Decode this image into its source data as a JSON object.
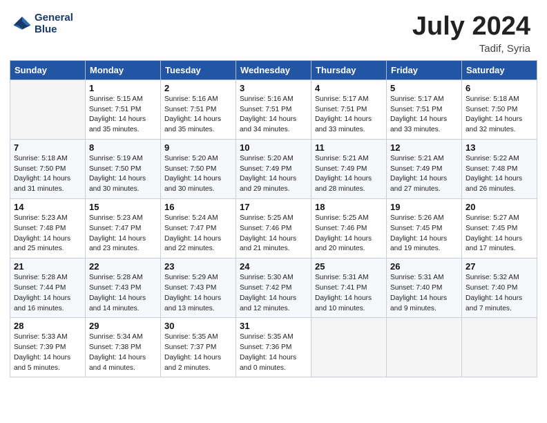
{
  "header": {
    "logo_line1": "General",
    "logo_line2": "Blue",
    "month": "July 2024",
    "location": "Tadif, Syria"
  },
  "weekdays": [
    "Sunday",
    "Monday",
    "Tuesday",
    "Wednesday",
    "Thursday",
    "Friday",
    "Saturday"
  ],
  "weeks": [
    [
      {
        "day": "",
        "info": ""
      },
      {
        "day": "1",
        "info": "Sunrise: 5:15 AM\nSunset: 7:51 PM\nDaylight: 14 hours\nand 35 minutes."
      },
      {
        "day": "2",
        "info": "Sunrise: 5:16 AM\nSunset: 7:51 PM\nDaylight: 14 hours\nand 35 minutes."
      },
      {
        "day": "3",
        "info": "Sunrise: 5:16 AM\nSunset: 7:51 PM\nDaylight: 14 hours\nand 34 minutes."
      },
      {
        "day": "4",
        "info": "Sunrise: 5:17 AM\nSunset: 7:51 PM\nDaylight: 14 hours\nand 33 minutes."
      },
      {
        "day": "5",
        "info": "Sunrise: 5:17 AM\nSunset: 7:51 PM\nDaylight: 14 hours\nand 33 minutes."
      },
      {
        "day": "6",
        "info": "Sunrise: 5:18 AM\nSunset: 7:50 PM\nDaylight: 14 hours\nand 32 minutes."
      }
    ],
    [
      {
        "day": "7",
        "info": "Sunrise: 5:18 AM\nSunset: 7:50 PM\nDaylight: 14 hours\nand 31 minutes."
      },
      {
        "day": "8",
        "info": "Sunrise: 5:19 AM\nSunset: 7:50 PM\nDaylight: 14 hours\nand 30 minutes."
      },
      {
        "day": "9",
        "info": "Sunrise: 5:20 AM\nSunset: 7:50 PM\nDaylight: 14 hours\nand 30 minutes."
      },
      {
        "day": "10",
        "info": "Sunrise: 5:20 AM\nSunset: 7:49 PM\nDaylight: 14 hours\nand 29 minutes."
      },
      {
        "day": "11",
        "info": "Sunrise: 5:21 AM\nSunset: 7:49 PM\nDaylight: 14 hours\nand 28 minutes."
      },
      {
        "day": "12",
        "info": "Sunrise: 5:21 AM\nSunset: 7:49 PM\nDaylight: 14 hours\nand 27 minutes."
      },
      {
        "day": "13",
        "info": "Sunrise: 5:22 AM\nSunset: 7:48 PM\nDaylight: 14 hours\nand 26 minutes."
      }
    ],
    [
      {
        "day": "14",
        "info": "Sunrise: 5:23 AM\nSunset: 7:48 PM\nDaylight: 14 hours\nand 25 minutes."
      },
      {
        "day": "15",
        "info": "Sunrise: 5:23 AM\nSunset: 7:47 PM\nDaylight: 14 hours\nand 23 minutes."
      },
      {
        "day": "16",
        "info": "Sunrise: 5:24 AM\nSunset: 7:47 PM\nDaylight: 14 hours\nand 22 minutes."
      },
      {
        "day": "17",
        "info": "Sunrise: 5:25 AM\nSunset: 7:46 PM\nDaylight: 14 hours\nand 21 minutes."
      },
      {
        "day": "18",
        "info": "Sunrise: 5:25 AM\nSunset: 7:46 PM\nDaylight: 14 hours\nand 20 minutes."
      },
      {
        "day": "19",
        "info": "Sunrise: 5:26 AM\nSunset: 7:45 PM\nDaylight: 14 hours\nand 19 minutes."
      },
      {
        "day": "20",
        "info": "Sunrise: 5:27 AM\nSunset: 7:45 PM\nDaylight: 14 hours\nand 17 minutes."
      }
    ],
    [
      {
        "day": "21",
        "info": "Sunrise: 5:28 AM\nSunset: 7:44 PM\nDaylight: 14 hours\nand 16 minutes."
      },
      {
        "day": "22",
        "info": "Sunrise: 5:28 AM\nSunset: 7:43 PM\nDaylight: 14 hours\nand 14 minutes."
      },
      {
        "day": "23",
        "info": "Sunrise: 5:29 AM\nSunset: 7:43 PM\nDaylight: 14 hours\nand 13 minutes."
      },
      {
        "day": "24",
        "info": "Sunrise: 5:30 AM\nSunset: 7:42 PM\nDaylight: 14 hours\nand 12 minutes."
      },
      {
        "day": "25",
        "info": "Sunrise: 5:31 AM\nSunset: 7:41 PM\nDaylight: 14 hours\nand 10 minutes."
      },
      {
        "day": "26",
        "info": "Sunrise: 5:31 AM\nSunset: 7:40 PM\nDaylight: 14 hours\nand 9 minutes."
      },
      {
        "day": "27",
        "info": "Sunrise: 5:32 AM\nSunset: 7:40 PM\nDaylight: 14 hours\nand 7 minutes."
      }
    ],
    [
      {
        "day": "28",
        "info": "Sunrise: 5:33 AM\nSunset: 7:39 PM\nDaylight: 14 hours\nand 5 minutes."
      },
      {
        "day": "29",
        "info": "Sunrise: 5:34 AM\nSunset: 7:38 PM\nDaylight: 14 hours\nand 4 minutes."
      },
      {
        "day": "30",
        "info": "Sunrise: 5:35 AM\nSunset: 7:37 PM\nDaylight: 14 hours\nand 2 minutes."
      },
      {
        "day": "31",
        "info": "Sunrise: 5:35 AM\nSunset: 7:36 PM\nDaylight: 14 hours\nand 0 minutes."
      },
      {
        "day": "",
        "info": ""
      },
      {
        "day": "",
        "info": ""
      },
      {
        "day": "",
        "info": ""
      }
    ]
  ]
}
